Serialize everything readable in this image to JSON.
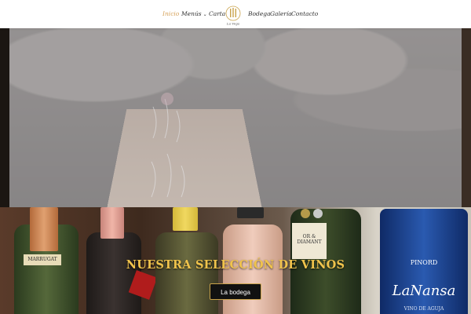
{
  "nav": {
    "items": [
      {
        "label": "Inicio",
        "active": true
      },
      {
        "label": "Menús",
        "has_dropdown": true
      },
      {
        "label": "Carta"
      },
      {
        "label": "Bodega"
      },
      {
        "label": "Galería"
      },
      {
        "label": "Contacto"
      }
    ],
    "logo_text": "La Vega"
  },
  "wine_section": {
    "title": "NUESTRA SELECCIÓN DE VINOS",
    "button_label": "La bodega",
    "bottle_labels": [
      "MARRUGAT",
      "OR & DIAMANT",
      "PINORD",
      "LaNansa",
      "VINO DE AGUJA"
    ]
  },
  "colors": {
    "accent": "#d6a25a",
    "title_gold": "#f0c34c"
  }
}
